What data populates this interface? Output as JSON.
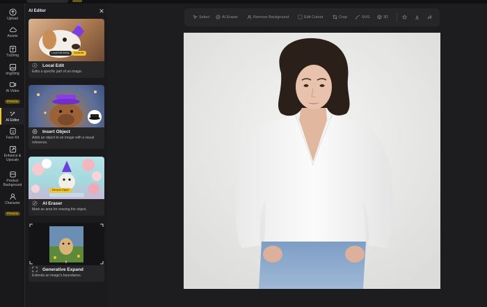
{
  "rail": {
    "items": [
      {
        "label": "Upload",
        "icon": "upload-icon"
      },
      {
        "label": "Assets",
        "icon": "cloud-icon"
      },
      {
        "label": "Txt2Img",
        "icon": "text-image-icon"
      },
      {
        "label": "Img2Img",
        "icon": "image-icon"
      },
      {
        "label": "AI Video",
        "icon": "video-icon",
        "badge": "Preview"
      },
      {
        "label": "AI Editor",
        "icon": "sparkle-edit-icon",
        "active": true
      },
      {
        "label": "Face Kit",
        "icon": "face-icon"
      },
      {
        "label": "Enhance & Upscale",
        "icon": "upscale-icon"
      },
      {
        "label": "Product Background",
        "icon": "product-icon"
      },
      {
        "label": "Character",
        "icon": "character-icon",
        "badge": "Preview"
      }
    ]
  },
  "panel": {
    "title": "AI Editor",
    "close_icon": "close-icon",
    "cards": [
      {
        "title": "Local Edit",
        "desc": "Edits a specific part of an image.",
        "icon": "local-edit-icon",
        "thumb_chips": [
          "Local Edit Ability",
          "Generate"
        ]
      },
      {
        "title": "Insert Object",
        "desc": "Adds an object to an image with a visual reference.",
        "icon": "insert-object-icon"
      },
      {
        "title": "AI Eraser",
        "desc": "Mark an area for erasing the object.",
        "icon": "eraser-icon",
        "thumb_chips": [
          "Remove Object"
        ]
      },
      {
        "title": "Generative Expand",
        "desc": "Extends an image's boundaries.",
        "icon": "expand-icon"
      }
    ]
  },
  "toolbar": {
    "items": [
      {
        "label": "Select",
        "icon": "select-icon"
      },
      {
        "label": "AI Eraser",
        "icon": "eraser-icon"
      },
      {
        "label": "Remove Background",
        "icon": "remove-bg-icon"
      },
      {
        "label": "Edit Cutout",
        "icon": "cutout-icon"
      },
      {
        "label": "Crop",
        "icon": "crop-icon"
      },
      {
        "label": "SVG",
        "icon": "svg-icon"
      },
      {
        "label": "3D",
        "icon": "3d-icon"
      }
    ],
    "actions": [
      "star-icon",
      "download-icon",
      "share-icon"
    ]
  },
  "colors": {
    "accent": "#f2c230",
    "background": "#1d1d1f",
    "panel": "#1b1b1d",
    "card": "#262628"
  }
}
